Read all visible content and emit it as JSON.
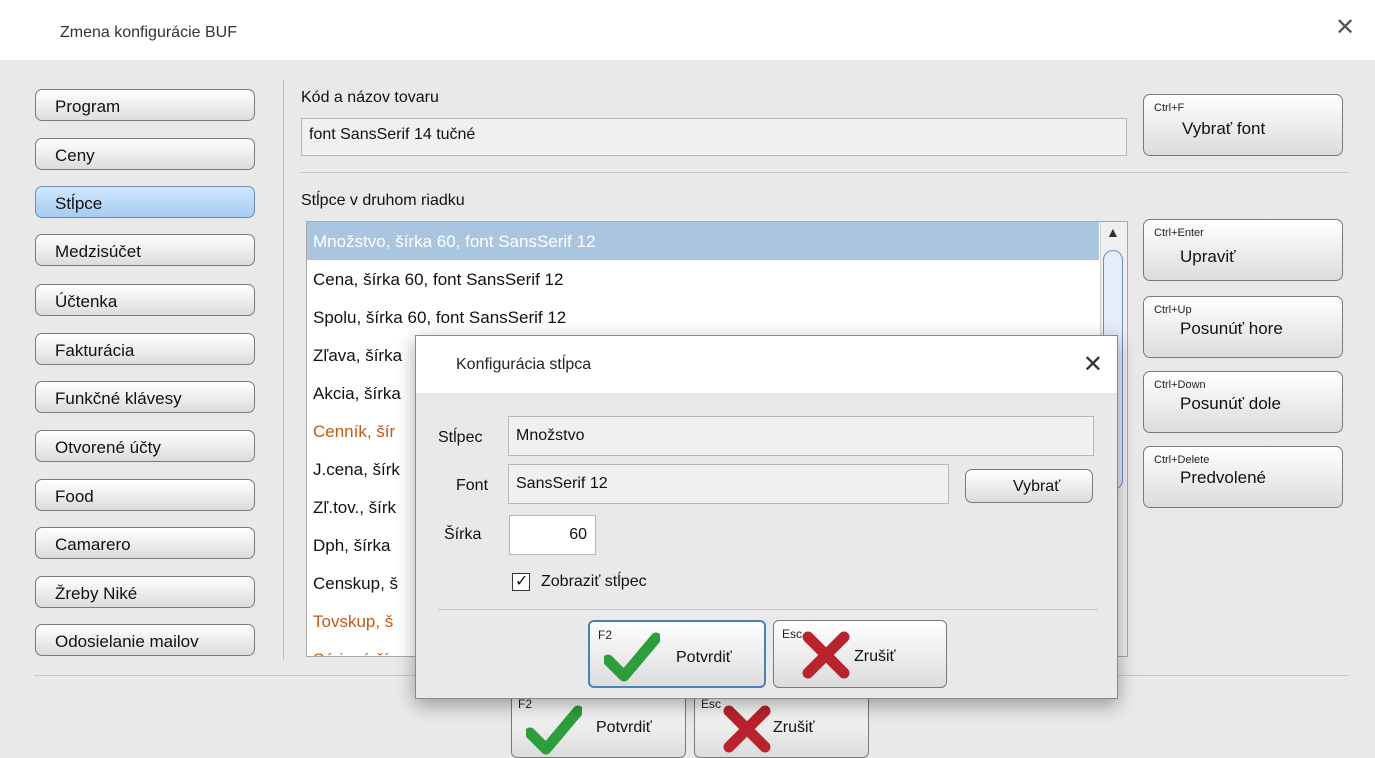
{
  "window": {
    "title": "Zmena konfigurácie BUF",
    "close_icon": "close-icon"
  },
  "nav": [
    {
      "label": "Program",
      "selected": false
    },
    {
      "label": "Ceny",
      "selected": false
    },
    {
      "label": "Stĺpce",
      "selected": true
    },
    {
      "label": "Medzisúčet",
      "selected": false
    },
    {
      "label": "Účtenka",
      "selected": false
    },
    {
      "label": "Fakturácia",
      "selected": false
    },
    {
      "label": "Funkčné klávesy",
      "selected": false
    },
    {
      "label": "Otvorené účty",
      "selected": false
    },
    {
      "label": "Food",
      "selected": false
    },
    {
      "label": "Camarero",
      "selected": false
    },
    {
      "label": "Žreby Niké",
      "selected": false
    },
    {
      "label": "Odosielanie mailov",
      "selected": false
    }
  ],
  "product": {
    "label": "Kód a názov tovaru",
    "value": "font SansSerif 14 tučné"
  },
  "columns_label": "Stĺpce v druhom riadku",
  "columns": [
    {
      "text": "Množstvo, šírka 60, font SansSerif 12",
      "selected": true,
      "orange": false
    },
    {
      "text": "Cena, šírka 60, font SansSerif 12",
      "selected": false,
      "orange": false
    },
    {
      "text": "Spolu, šírka 60, font SansSerif 12",
      "selected": false,
      "orange": false
    },
    {
      "text": "Zľava, šírka",
      "selected": false,
      "orange": false
    },
    {
      "text": "Akcia, šírka",
      "selected": false,
      "orange": false
    },
    {
      "text": "Cenník, šír",
      "selected": false,
      "orange": true
    },
    {
      "text": "J.cena, šírk",
      "selected": false,
      "orange": false
    },
    {
      "text": "Zľ.tov., šírk",
      "selected": false,
      "orange": false
    },
    {
      "text": "Dph, šírka",
      "selected": false,
      "orange": false
    },
    {
      "text": "Censkup, š",
      "selected": false,
      "orange": false
    },
    {
      "text": "Tovskup, š",
      "selected": false,
      "orange": true
    },
    {
      "text": "Sériové čís",
      "selected": false,
      "orange": true
    }
  ],
  "side_buttons": [
    {
      "shortcut": "Ctrl+F",
      "label": "Vybrať font"
    },
    {
      "shortcut": "Ctrl+Enter",
      "label": "Upraviť"
    },
    {
      "shortcut": "Ctrl+Up",
      "label": "Posunúť hore"
    },
    {
      "shortcut": "Ctrl+Down",
      "label": "Posunúť dole"
    },
    {
      "shortcut": "Ctrl+Delete",
      "label": "Predvolené"
    }
  ],
  "bottom": {
    "confirm": {
      "shortcut": "F2",
      "label": "Potvrdiť"
    },
    "cancel": {
      "shortcut": "Esc",
      "label": "Zrušiť"
    }
  },
  "dialog": {
    "title": "Konfigurácia stĺpca",
    "column_label": "Stĺpec",
    "column_value": "Množstvo",
    "font_label": "Font",
    "font_value": "SansSerif 12",
    "choose_label": "Vybrať",
    "width_label": "Šírka",
    "width_value": "60",
    "show_label": "Zobraziť stĺpec",
    "show_checked": true,
    "confirm": {
      "shortcut": "F2",
      "label": "Potvrdiť"
    },
    "cancel": {
      "shortcut": "Esc",
      "label": "Zrušiť"
    }
  },
  "colors": {
    "accent_selected": "#a9c5df",
    "orange_text": "#c05a16",
    "check_green": "#2e9e3c",
    "cross_red": "#b8232d"
  }
}
